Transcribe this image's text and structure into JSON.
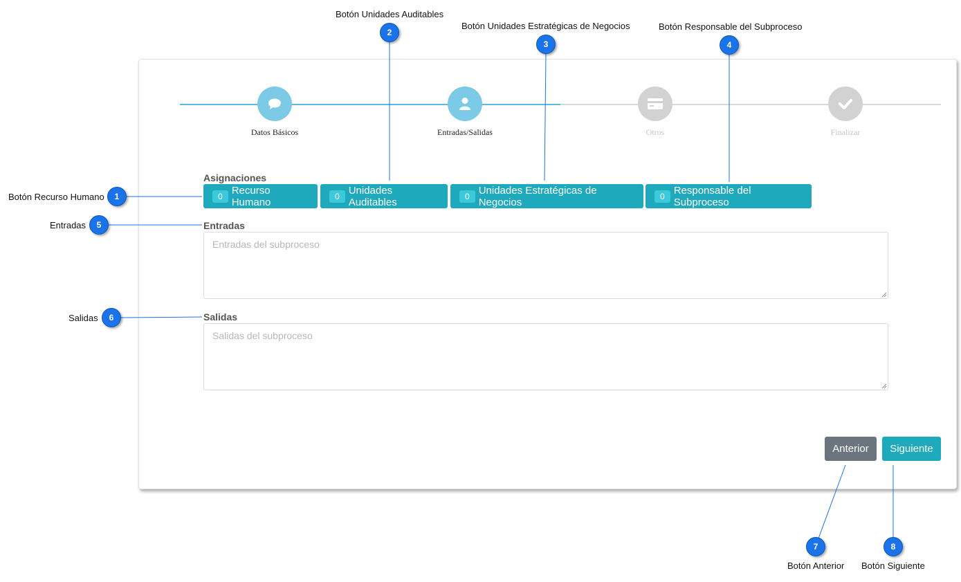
{
  "wizard": {
    "steps": [
      {
        "label": "Datos Básicos",
        "icon": "speech-bubble-icon",
        "state": "active"
      },
      {
        "label": "Entradas/Salidas",
        "icon": "user-icon",
        "state": "active"
      },
      {
        "label": "Otros",
        "icon": "credit-card-icon",
        "state": "inactive"
      },
      {
        "label": "Finalizar",
        "icon": "check-icon",
        "state": "inactive"
      }
    ]
  },
  "asignaciones": {
    "title": "Asignaciones",
    "buttons": [
      {
        "count": "0",
        "label": "Recurso Humano"
      },
      {
        "count": "0",
        "label": "Unidades Auditables"
      },
      {
        "count": "0",
        "label": "Unidades Estratégicas de Negocios"
      },
      {
        "count": "0",
        "label": "Responsable del Subproceso"
      }
    ]
  },
  "entradas": {
    "label": "Entradas",
    "placeholder": "Entradas del subproceso"
  },
  "salidas": {
    "label": "Salidas",
    "placeholder": "Salidas del subproceso"
  },
  "nav": {
    "prev_label": "Anterior",
    "next_label": "Siguiente"
  },
  "callouts": [
    {
      "number": "1",
      "text": "Botón Recurso Humano"
    },
    {
      "number": "2",
      "text": "Botón Unidades Auditables"
    },
    {
      "number": "3",
      "text": "Botón Unidades Estratégicas de Negocios"
    },
    {
      "number": "4",
      "text": "Botón Responsable del Subproceso"
    },
    {
      "number": "5",
      "text": "Entradas"
    },
    {
      "number": "6",
      "text": "Salidas"
    },
    {
      "number": "7",
      "text": "Botón Anterior"
    },
    {
      "number": "8",
      "text": "Botón Siguiente"
    }
  ],
  "colors": {
    "accent": "#1fa9bd",
    "step_active": "#7ccae6",
    "step_inactive": "#d2d2d2",
    "prev_button": "#6c757d",
    "marker": "#1a73e8"
  }
}
